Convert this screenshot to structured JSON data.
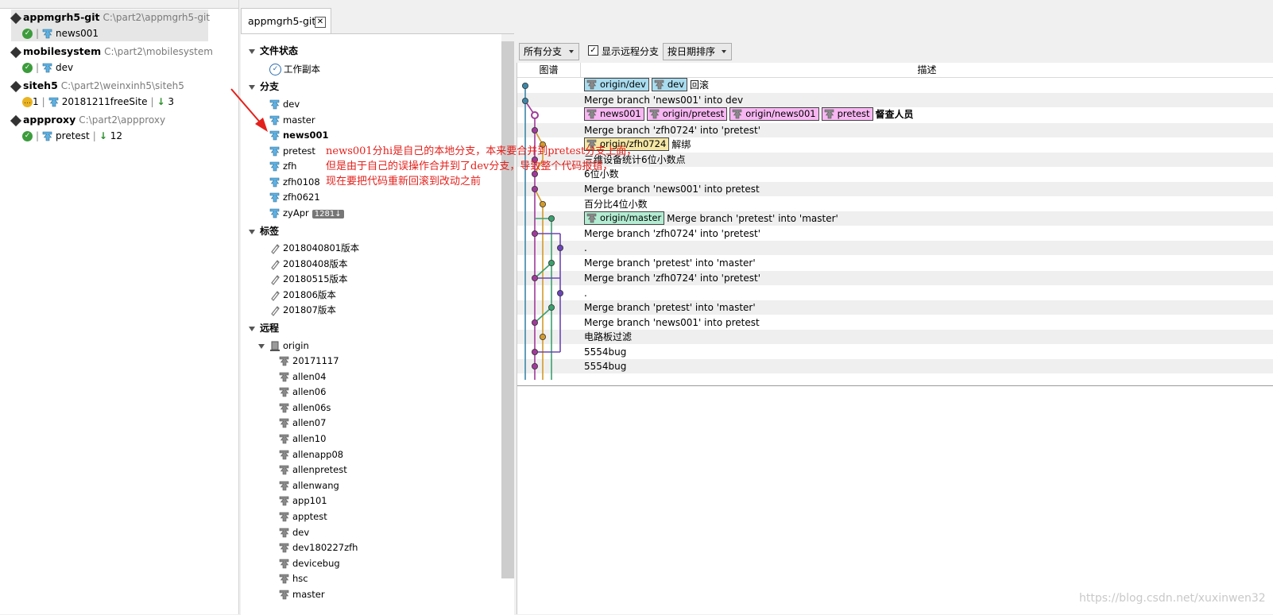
{
  "repos": [
    {
      "name": "appmgrh5-git",
      "path": "C:\\part2\\appmgrh5-git",
      "status": "ok",
      "branch": "news001",
      "count": "",
      "behind": "",
      "selected": true
    },
    {
      "name": "mobilesystem",
      "path": "C:\\part2\\mobilesystem",
      "status": "ok",
      "branch": "dev",
      "count": "",
      "behind": "",
      "selected": false
    },
    {
      "name": "siteh5",
      "path": "C:\\part2\\weinxinh5\\siteh5",
      "status": "warn",
      "branch": "20181211freeSite",
      "count": "1",
      "behind": "3",
      "selected": false
    },
    {
      "name": "appproxy",
      "path": "C:\\part2\\appproxy",
      "status": "ok",
      "branch": "pretest",
      "count": "",
      "behind": "12",
      "selected": false
    }
  ],
  "tab": {
    "label": "appmgrh5-git",
    "close": "✕"
  },
  "sidebar": {
    "file_status": {
      "title": "文件状态",
      "items": [
        "工作副本"
      ]
    },
    "branches": {
      "title": "分支",
      "items": [
        "dev",
        "master",
        "news001",
        "pretest",
        "zfh",
        "zfh0108",
        "zfh0621",
        "zyApr"
      ],
      "current": "news001",
      "zyApr_badge": "1281↓"
    },
    "tags": {
      "title": "标签",
      "items": [
        "2018040801版本",
        "20180408版本",
        "20180515版本",
        "201806版本",
        "201807版本"
      ]
    },
    "remotes": {
      "title": "远程",
      "origin": "origin",
      "items": [
        "20171117",
        "allen04",
        "allen06",
        "allen06s",
        "allen07",
        "allen10",
        "allenapp08",
        "allenpretest",
        "allenwang",
        "app101",
        "apptest",
        "dev",
        "dev180227zfh",
        "devicebug",
        "hsc",
        "master"
      ]
    }
  },
  "toolbar": {
    "branches_combo": "所有分支",
    "show_remote_label": "显示远程分支",
    "show_remote_checked": true,
    "sort_combo": "按日期排序"
  },
  "columns": {
    "graph": "图谱",
    "description": "描述"
  },
  "commits": [
    {
      "refs": [
        {
          "name": "origin/dev",
          "color": "#a9dcef"
        },
        {
          "name": "dev",
          "color": "#a9dcef"
        }
      ],
      "msg": "回滚"
    },
    {
      "refs": [],
      "msg": "Merge branch 'news001' into dev"
    },
    {
      "refs": [
        {
          "name": "news001",
          "color": "#f7b7f2"
        },
        {
          "name": "origin/pretest",
          "color": "#f7b7f2"
        },
        {
          "name": "origin/news001",
          "color": "#f7b7f2"
        },
        {
          "name": "pretest",
          "color": "#f7b7f2"
        }
      ],
      "msg": "督查人员",
      "msg_bold": true
    },
    {
      "refs": [],
      "msg": "Merge branch 'zfh0724' into 'pretest'"
    },
    {
      "refs": [
        {
          "name": "origin/zfh0724",
          "color": "#f5e7a6"
        }
      ],
      "msg": "解绑"
    },
    {
      "refs": [],
      "msg": "三维设备统计6位小数点"
    },
    {
      "refs": [],
      "msg": "6位小数"
    },
    {
      "refs": [],
      "msg": "Merge branch 'news001' into pretest"
    },
    {
      "refs": [],
      "msg": "百分比4位小数"
    },
    {
      "refs": [
        {
          "name": "origin/master",
          "color": "#b3ecd2"
        }
      ],
      "msg": "Merge branch 'pretest' into 'master'"
    },
    {
      "refs": [],
      "msg": "Merge branch 'zfh0724' into 'pretest'"
    },
    {
      "refs": [],
      "msg": "."
    },
    {
      "refs": [],
      "msg": "Merge branch 'pretest' into 'master'"
    },
    {
      "refs": [],
      "msg": "Merge branch 'zfh0724' into 'pretest'"
    },
    {
      "refs": [],
      "msg": "."
    },
    {
      "refs": [],
      "msg": "Merge branch 'pretest' into 'master'"
    },
    {
      "refs": [],
      "msg": "Merge branch 'news001' into pretest"
    },
    {
      "refs": [],
      "msg": "电路板过滤"
    },
    {
      "refs": [],
      "msg": "5554bug"
    },
    {
      "refs": [],
      "msg": "5554bug"
    }
  ],
  "annotation": {
    "line1": "news001分hi是自己的本地分支，本来要合并到pretest分支上面，",
    "line2": "但是由于自己的误操作合并到了dev分支，导致整个代码报错，",
    "line3": "现在要把代码重新回滚到改动之前"
  },
  "watermark": "https://blog.csdn.net/xuxinwen32",
  "colors": {
    "lane_blue": "#3d86a8",
    "lane_purple": "#a03a9a",
    "lane_orange": "#d39a2a",
    "lane_green": "#3aa06e",
    "lane_violet": "#6b45b8",
    "annotation": "#e3211c"
  }
}
